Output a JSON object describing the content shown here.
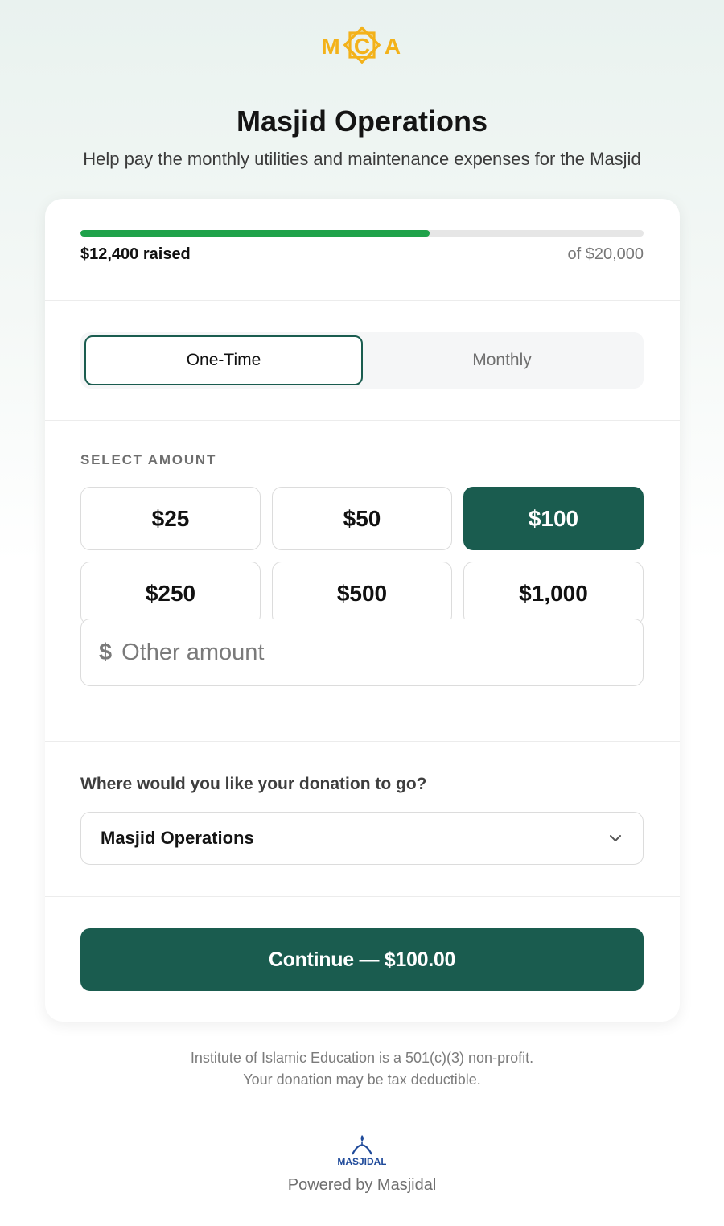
{
  "brand": {
    "logo_text": "MCA",
    "logo_color": "#f3b21a"
  },
  "header": {
    "title": "Masjid Operations",
    "subtitle": "Help pay the monthly utilities and maintenance expenses for the Masjid"
  },
  "progress": {
    "raised_label": "$12,400 raised",
    "goal_label": "of $20,000",
    "fraction": 0.62,
    "color": "#1fa24a"
  },
  "frequency": {
    "options": [
      "One-Time",
      "Monthly"
    ],
    "selected": "One-Time"
  },
  "amount": {
    "label": "SELECT AMOUNT",
    "options": [
      "$25",
      "$50",
      "$100",
      "$250",
      "$500",
      "$1,000"
    ],
    "selected": "$100",
    "other_symbol": "$",
    "other_placeholder": "Other amount"
  },
  "destination": {
    "label": "Where would you like your donation to go?",
    "selected": "Masjid Operations"
  },
  "continue": {
    "label": "Continue — $100.00"
  },
  "footer": {
    "line1": "Institute of Islamic Education is a 501(c)(3) non-profit.",
    "line2": "Your donation may be tax deductible.",
    "powered_by": "Powered by Masjidal",
    "masjidal_logo_text": "MASJIDAL"
  },
  "colors": {
    "primary": "#1a5c4f",
    "accent_green": "#1fa24a",
    "masjidal_blue": "#1f4a9a"
  }
}
